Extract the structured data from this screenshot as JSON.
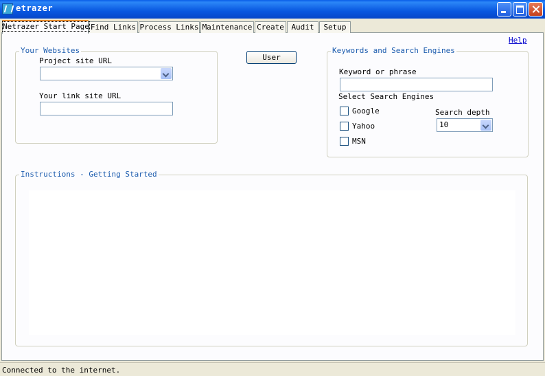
{
  "window": {
    "title": "etrazer"
  },
  "tabs": [
    "Netrazer Start Page",
    "Find Links",
    "Process Links",
    "Maintenance",
    "Create",
    "Audit",
    "Setup"
  ],
  "help_link": "Help",
  "websites": {
    "legend": "Your Websites",
    "project_url_label": "Project site URL",
    "project_url_value": "",
    "link_url_label": "Your link site URL",
    "link_url_value": ""
  },
  "user_button": "User",
  "keywords": {
    "legend": "Keywords and Search Engines",
    "keyword_label": "Keyword or phrase",
    "keyword_value": "",
    "engines_label": "Select Search Engines",
    "engines": [
      {
        "label": "Google",
        "checked": false
      },
      {
        "label": "Yahoo",
        "checked": false
      },
      {
        "label": "MSN",
        "checked": false
      }
    ],
    "depth_label": "Search depth",
    "depth_value": "10"
  },
  "instructions": {
    "legend": "Instructions - Getting Started"
  },
  "status": "Connected to the internet."
}
